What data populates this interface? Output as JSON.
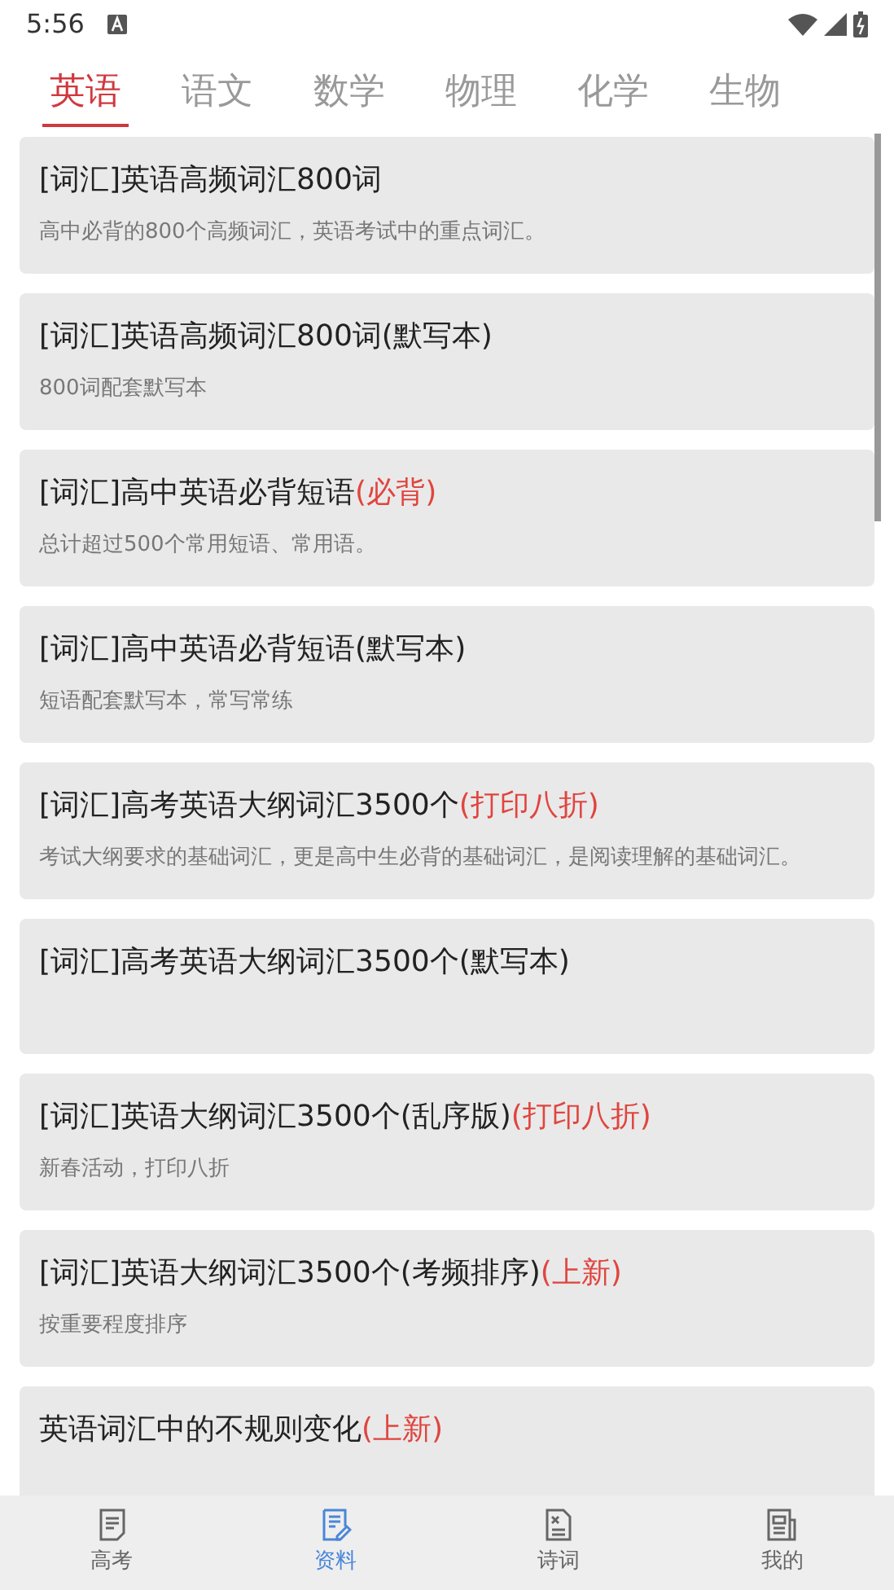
{
  "status_bar": {
    "time": "5:56"
  },
  "tabs": [
    {
      "label": "英语",
      "selected": true
    },
    {
      "label": "语文",
      "selected": false
    },
    {
      "label": "数学",
      "selected": false
    },
    {
      "label": "物理",
      "selected": false
    },
    {
      "label": "化学",
      "selected": false
    },
    {
      "label": "生物",
      "selected": false
    }
  ],
  "items": [
    {
      "title": "[词汇]英语高频词汇800词",
      "description": "高中必背的800个高频词汇，英语考试中的重点词汇。"
    },
    {
      "title": "[词汇]英语高频词汇800词(默写本)",
      "description": "800词配套默写本"
    },
    {
      "title": "[词汇]高中英语必背短语",
      "tag": "(必背)",
      "description": "总计超过500个常用短语、常用语。"
    },
    {
      "title": "[词汇]高中英语必背短语(默写本)",
      "description": "短语配套默写本，常写常练"
    },
    {
      "title": "[词汇]高考英语大纲词汇3500个",
      "tag": "(打印八折)",
      "description": "考试大纲要求的基础词汇，更是高中生必背的基础词汇，是阅读理解的基础词汇。"
    },
    {
      "title": "[词汇]高考英语大纲词汇3500个(默写本)"
    },
    {
      "title": "[词汇]英语大纲词汇3500个(乱序版)",
      "tag": "(打印八折)",
      "description": "新春活动，打印八折"
    },
    {
      "title": "[词汇]英语大纲词汇3500个(考频排序)",
      "tag": "(上新)",
      "description": "按重要程度排序"
    },
    {
      "title": "英语词汇中的不规则变化",
      "tag": "(上新)"
    }
  ],
  "bottom_nav": [
    {
      "label": "高考",
      "selected": false
    },
    {
      "label": "资料",
      "selected": true
    },
    {
      "label": "诗词",
      "selected": false
    },
    {
      "label": "我的",
      "selected": false
    }
  ]
}
